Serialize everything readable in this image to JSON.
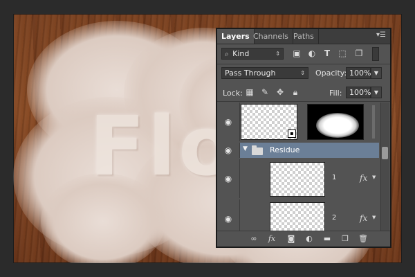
{
  "canvas": {
    "text": "Flo"
  },
  "panel": {
    "tabs": [
      {
        "label": "Layers"
      },
      {
        "label": "Channels"
      },
      {
        "label": "Paths"
      }
    ],
    "menu_icon": "panel-menu-icon",
    "filter": {
      "kind_label": "Kind",
      "icons": [
        "image-filter-icon",
        "adjustment-filter-icon",
        "type-filter-icon",
        "shape-filter-icon",
        "smart-object-filter-icon"
      ]
    },
    "blend_mode": "Pass Through",
    "opacity_label": "Opacity:",
    "opacity_value": "100%",
    "lock_label": "Lock:",
    "fill_label": "Fill:",
    "fill_value": "100%",
    "layers": [
      {
        "type": "masked-layer",
        "name": ""
      },
      {
        "type": "group",
        "name": "Residue"
      },
      {
        "type": "layer",
        "name": "1",
        "fx": "fx"
      },
      {
        "type": "layer",
        "name": "2",
        "fx": "fx"
      }
    ],
    "bottom_icons": [
      "link-icon",
      "fx-icon",
      "mask-icon",
      "adjustment-icon",
      "group-icon",
      "new-layer-icon",
      "trash-icon"
    ],
    "fx_label": "fx"
  }
}
